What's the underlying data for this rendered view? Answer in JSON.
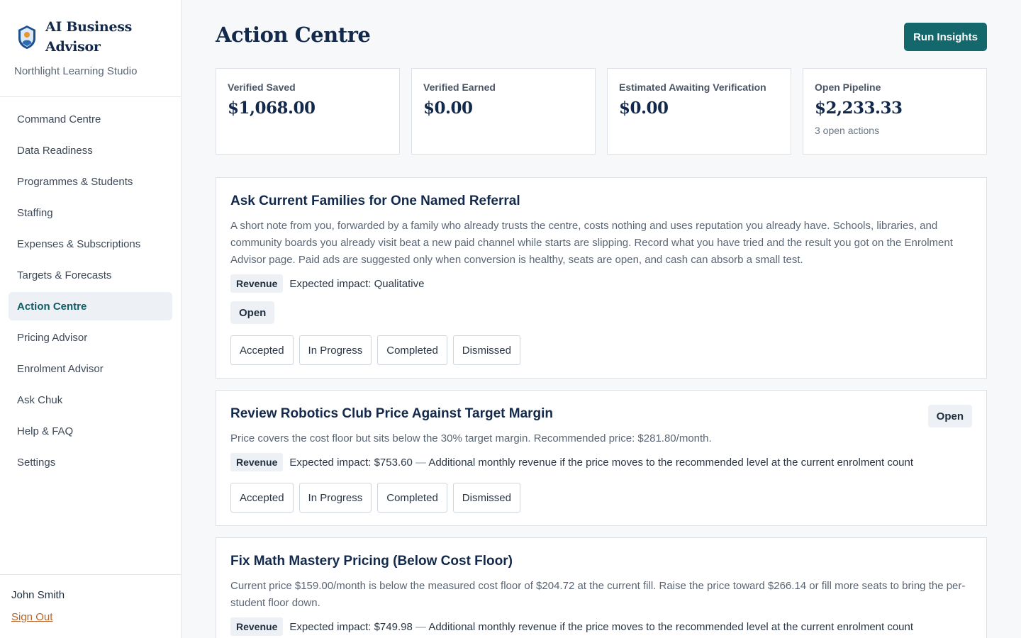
{
  "app": {
    "name_line1": "AI Business",
    "name_line2": "Advisor",
    "org": "Northlight Learning Studio",
    "logo_icon": "shield-person-logo"
  },
  "nav": {
    "items": [
      {
        "label": "Command Centre",
        "active": false
      },
      {
        "label": "Data Readiness",
        "active": false
      },
      {
        "label": "Programmes & Students",
        "active": false
      },
      {
        "label": "Staffing",
        "active": false
      },
      {
        "label": "Expenses & Subscriptions",
        "active": false
      },
      {
        "label": "Targets & Forecasts",
        "active": false
      },
      {
        "label": "Action Centre",
        "active": true
      },
      {
        "label": "Pricing Advisor",
        "active": false
      },
      {
        "label": "Enrolment Advisor",
        "active": false
      },
      {
        "label": "Ask Chuk",
        "active": false
      },
      {
        "label": "Help & FAQ",
        "active": false
      },
      {
        "label": "Settings",
        "active": false
      }
    ]
  },
  "user": {
    "name": "John Smith",
    "sign_out": "Sign Out"
  },
  "page": {
    "title": "Action Centre",
    "run_button": "Run Insights"
  },
  "stats": [
    {
      "label": "Verified Saved",
      "value": "$1,068.00",
      "sub": ""
    },
    {
      "label": "Verified Earned",
      "value": "$0.00",
      "sub": ""
    },
    {
      "label": "Estimated Awaiting Verification",
      "value": "$0.00",
      "sub": ""
    },
    {
      "label": "Open Pipeline",
      "value": "$2,233.33",
      "sub": "3 open actions"
    }
  ],
  "actions": {
    "buttons": [
      "Accepted",
      "In Progress",
      "Completed",
      "Dismissed"
    ],
    "cards": [
      {
        "title": "Ask Current Families for One Named Referral",
        "description": "A short note from you, forwarded by a family who already trusts the centre, costs nothing and uses reputation you already have. Schools, libraries, and community boards you already visit beat a new paid channel while starts are slipping. Record what you have tried and the result you got on the Enrolment Advisor page. Paid ads are suggested only when conversion is healthy, seats are open, and cash can absorb a small test.",
        "category": "Revenue",
        "impact": "Expected impact: Qualitative",
        "impact_detail": "",
        "status": "Open"
      },
      {
        "title": "Review Robotics Club Price Against Target Margin",
        "description": "Price covers the cost floor but sits below the 30% target margin. Recommended price: $281.80/month.",
        "category": "Revenue",
        "impact": "Expected impact: $753.60",
        "impact_detail": "Additional monthly revenue if the price moves to the recommended level at the current enrolment count",
        "status": "Open"
      },
      {
        "title": "Fix Math Mastery Pricing (Below Cost Floor)",
        "description": "Current price $159.00/month is below the measured cost floor of $204.72 at the current fill. Raise the price toward $266.14 or fill more seats to bring the per-student floor down.",
        "category": "Revenue",
        "impact": "Expected impact: $749.98",
        "impact_detail": "Additional monthly revenue if the price moves to the recommended level at the current enrolment count",
        "status": ""
      }
    ]
  },
  "colors": {
    "primary": "#14676b",
    "heading": "#13294b",
    "active_nav_bg": "#edf0f4",
    "sign_out": "#b7652b"
  }
}
